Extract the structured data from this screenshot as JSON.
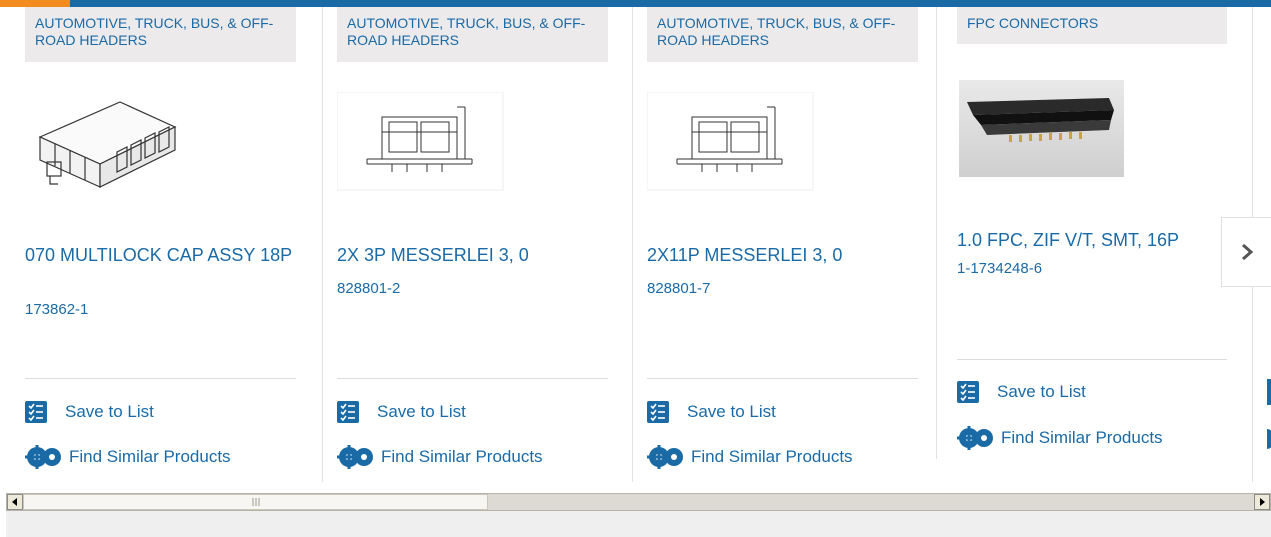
{
  "products": [
    {
      "category": "AUTOMOTIVE, TRUCK, BUS, & OFF-ROAD HEADERS",
      "title": "070 MULTILOCK CAP ASSY 18P",
      "part_number": "173862-1",
      "image_icon": "header-connector-image"
    },
    {
      "category": "AUTOMOTIVE, TRUCK, BUS, & OFF-ROAD HEADERS",
      "title": "2X 3P MESSERLEI 3, 0",
      "part_number": "828801-2",
      "image_icon": "messerlei-connector-drawing"
    },
    {
      "category": "AUTOMOTIVE, TRUCK, BUS, & OFF-ROAD HEADERS",
      "title": "2X11P MESSERLEI 3, 0",
      "part_number": "828801-7",
      "image_icon": "messerlei-connector-drawing"
    },
    {
      "category": "FPC CONNECTORS",
      "title": "1.0 FPC, ZIF V/T, SMT, 16P",
      "part_number": "1-1734248-6",
      "image_icon": "fpc-connector-photo"
    }
  ],
  "actions": {
    "save_label": "Save to List",
    "similar_label": "Find Similar Products"
  },
  "icons": {
    "save": "checklist-icon",
    "similar": "gears-icon",
    "next": "chevron-right-icon"
  },
  "colors": {
    "link": "#1a6aa6",
    "accent": "#f28c1e",
    "category_bg": "#eceaea"
  }
}
